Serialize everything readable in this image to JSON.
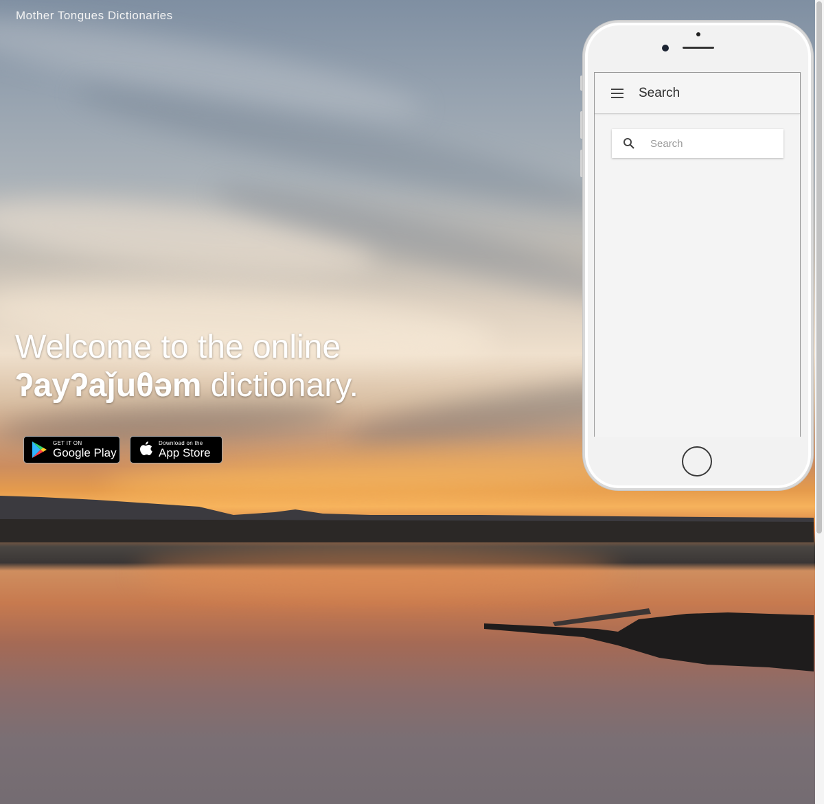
{
  "header": {
    "brand": "Mother Tongues Dictionaries"
  },
  "hero": {
    "line1": "Welcome to the online",
    "language": "ʔayʔaǰuθəm",
    "line2_suffix": " dictionary."
  },
  "stores": {
    "google": {
      "small": "GET IT ON",
      "big": "Google Play"
    },
    "apple": {
      "small": "Download on the",
      "big": "App Store"
    }
  },
  "phone_app": {
    "appbar_title": "Search",
    "search_placeholder": "Search"
  },
  "icons": {
    "menu": "hamburger-menu-icon",
    "search": "search-icon",
    "google_play": "google-play-logo",
    "apple": "apple-logo"
  }
}
